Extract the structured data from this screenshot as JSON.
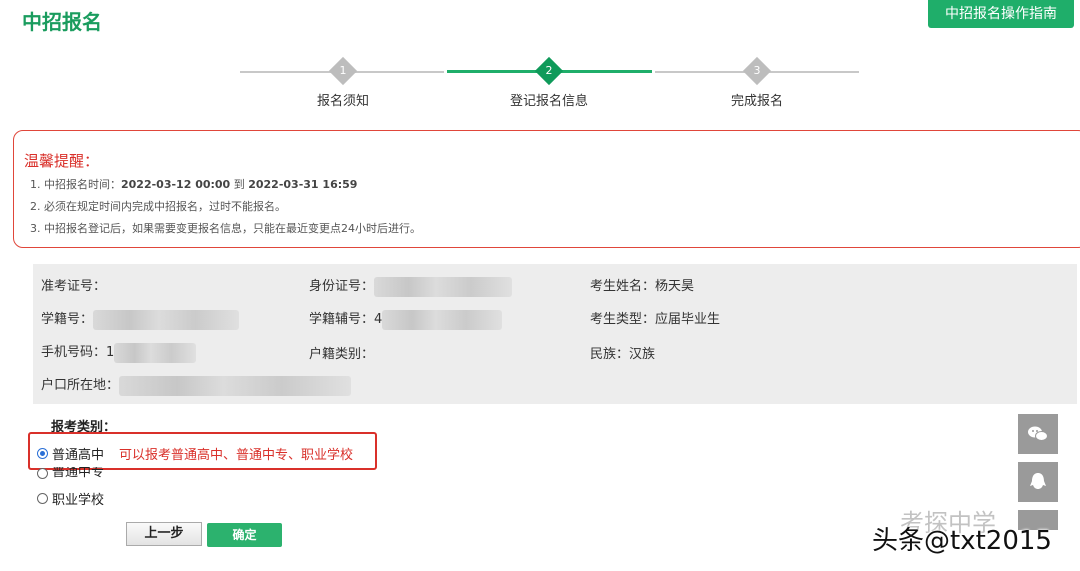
{
  "header": {
    "title": "中招报名",
    "guide_button": "中招报名操作指南"
  },
  "steps": [
    {
      "num": "1",
      "label": "报名须知"
    },
    {
      "num": "2",
      "label": "登记报名信息"
    },
    {
      "num": "3",
      "label": "完成报名"
    }
  ],
  "notice": {
    "title": "温馨提醒：",
    "line1_prefix": "1. 中招报名时间：",
    "line1_start": "2022-03-12 00:00",
    "line1_mid": " 到 ",
    "line1_end": "2022-03-31 16:59",
    "line2": "2. 必须在规定时间内完成中招报名，过时不能报名。",
    "line3": "3. 中招报名登记后，如果需要变更报名信息，只能在最近变更点24小时后进行。"
  },
  "info": {
    "exam_no_label": "准考证号：",
    "id_label": "身份证号：",
    "name_label": "考生姓名：",
    "name_value": "杨天昊",
    "student_no_label": "学籍号：",
    "student_aux_label": "学籍辅号：4",
    "type_label": "考生类型：",
    "type_value": "应届毕业生",
    "phone_label": "手机号码：1",
    "household_label": "户籍类别：",
    "ethnicity_label": "民族：",
    "ethnicity_value": "汉族",
    "address_label": "户口所在地："
  },
  "category": {
    "label": "报考类别：",
    "options": [
      "普通高中",
      "普通中专",
      "职业学校"
    ],
    "selected": "普通高中",
    "hint": "可以报考普通高中、普通中专、职业学校"
  },
  "buttons": {
    "prev": "上一步",
    "ok": "确定"
  },
  "watermark": {
    "text": "头条@txt2015",
    "faded": "考探中学"
  },
  "colors": {
    "accent": "#1fae6a",
    "alert": "#d9302a"
  }
}
